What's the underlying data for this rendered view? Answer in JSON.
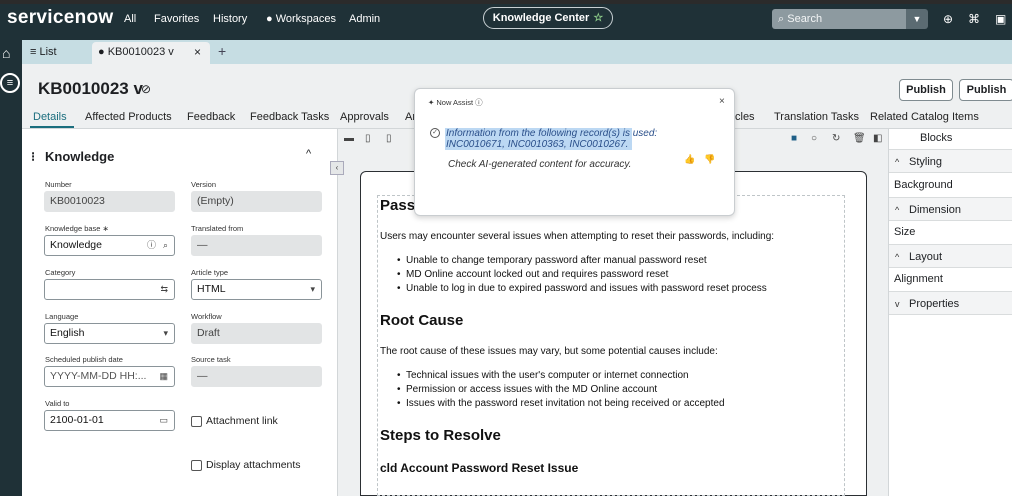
{
  "top": {
    "brand": "servicenow",
    "nav": [
      "All",
      "Favorites",
      "History",
      "● Workspaces",
      "Admin"
    ],
    "center_pill": "Knowledge Center",
    "search_placeholder": "Search"
  },
  "tabs": {
    "list_label": "List",
    "active_label": "KB0010023 v"
  },
  "record": {
    "title": "KB0010023 v",
    "publish_1": "Publish",
    "publish_2": "Publish"
  },
  "subtabs": [
    "Details",
    "Affected Products",
    "Feedback",
    "Feedback Tasks",
    "Approvals",
    "Ar",
    "cles",
    "Translation Tasks",
    "Related Catalog Items"
  ],
  "form": {
    "section": "Knowledge",
    "number_label": "Number",
    "number_value": "KB0010023",
    "version_label": "Version",
    "version_value": "(Empty)",
    "kb_label": "Knowledge base ∗",
    "kb_value": "Knowledge",
    "translated_label": "Translated from",
    "translated_value": "—",
    "category_label": "Category",
    "category_value": "",
    "article_type_label": "Article type",
    "article_type_value": "HTML",
    "language_label": "Language",
    "language_value": "English",
    "workflow_label": "Workflow",
    "workflow_value": "Draft",
    "sched_label": "Scheduled publish date",
    "sched_placeholder": "YYYY-MM-DD HH:...",
    "source_label": "Source task",
    "source_value": "—",
    "valid_label": "Valid to",
    "valid_value": "2100-01-01",
    "attachment_link": "Attachment link",
    "display_attachments": "Display attachments"
  },
  "doc": {
    "heading1": "Pass",
    "intro": "Users may encounter several issues when attempting to reset their passwords, including:",
    "issues": [
      "Unable to change temporary password after manual password reset",
      "MD Online account locked out and requires password reset",
      "Unable to log in due to expired password and issues with password reset process"
    ],
    "heading2": "Root Cause",
    "cause_intro": "The root cause of these issues may vary, but some potential causes include:",
    "causes": [
      "Technical issues with the user's computer or internet connection",
      "Permission or access issues with the MD Online account",
      "Issues with the password reset invitation not being received or accepted"
    ],
    "heading3": "Steps to Resolve",
    "heading4": "cld Account Password Reset Issue"
  },
  "right_panel": {
    "blocks": "Blocks",
    "styling": "Styling",
    "background": "Background",
    "dimension": "Dimension",
    "size": "Size",
    "layout": "Layout",
    "alignment": "Alignment",
    "properties": "Properties"
  },
  "assist": {
    "title": "Now Assist",
    "message": "Information from the following record(s) is used: INC0010671, INC0010363, INC0010267.",
    "note": "Check AI-generated content for accuracy."
  }
}
